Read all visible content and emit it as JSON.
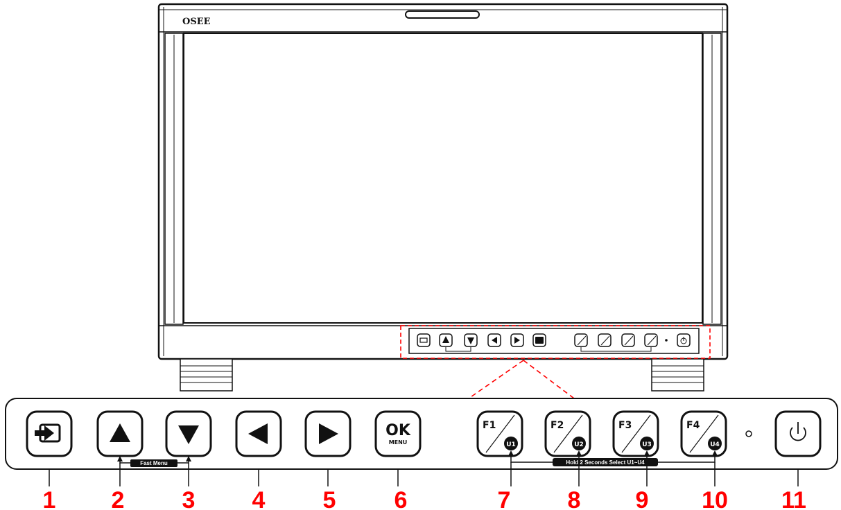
{
  "monitor": {
    "brand": "OSEE",
    "mini_panel": [
      "input",
      "up",
      "down",
      "left",
      "right",
      "ok",
      "f1",
      "f2",
      "f3",
      "f4",
      "power"
    ]
  },
  "panel": {
    "keys": {
      "ok_label": "OK",
      "menu_label": "MENU",
      "f_keys": [
        {
          "f": "F1",
          "u": "U1"
        },
        {
          "f": "F2",
          "u": "U2"
        },
        {
          "f": "F3",
          "u": "U3"
        },
        {
          "f": "F4",
          "u": "U4"
        }
      ]
    },
    "fast_menu_label": "Fast Menu",
    "hold_label": "Hold 2 Seconds Select U1~U4"
  },
  "callouts": [
    "1",
    "2",
    "3",
    "4",
    "5",
    "6",
    "7",
    "8",
    "9",
    "10",
    "11"
  ],
  "icons": [
    "input-icon",
    "up-arrow-icon",
    "down-arrow-icon",
    "left-arrow-icon",
    "right-arrow-icon",
    "ok-menu-icon",
    "power-icon"
  ],
  "colors": {
    "outline": "#111111",
    "callout": "#ff0000",
    "highlight": "#ff0000"
  }
}
